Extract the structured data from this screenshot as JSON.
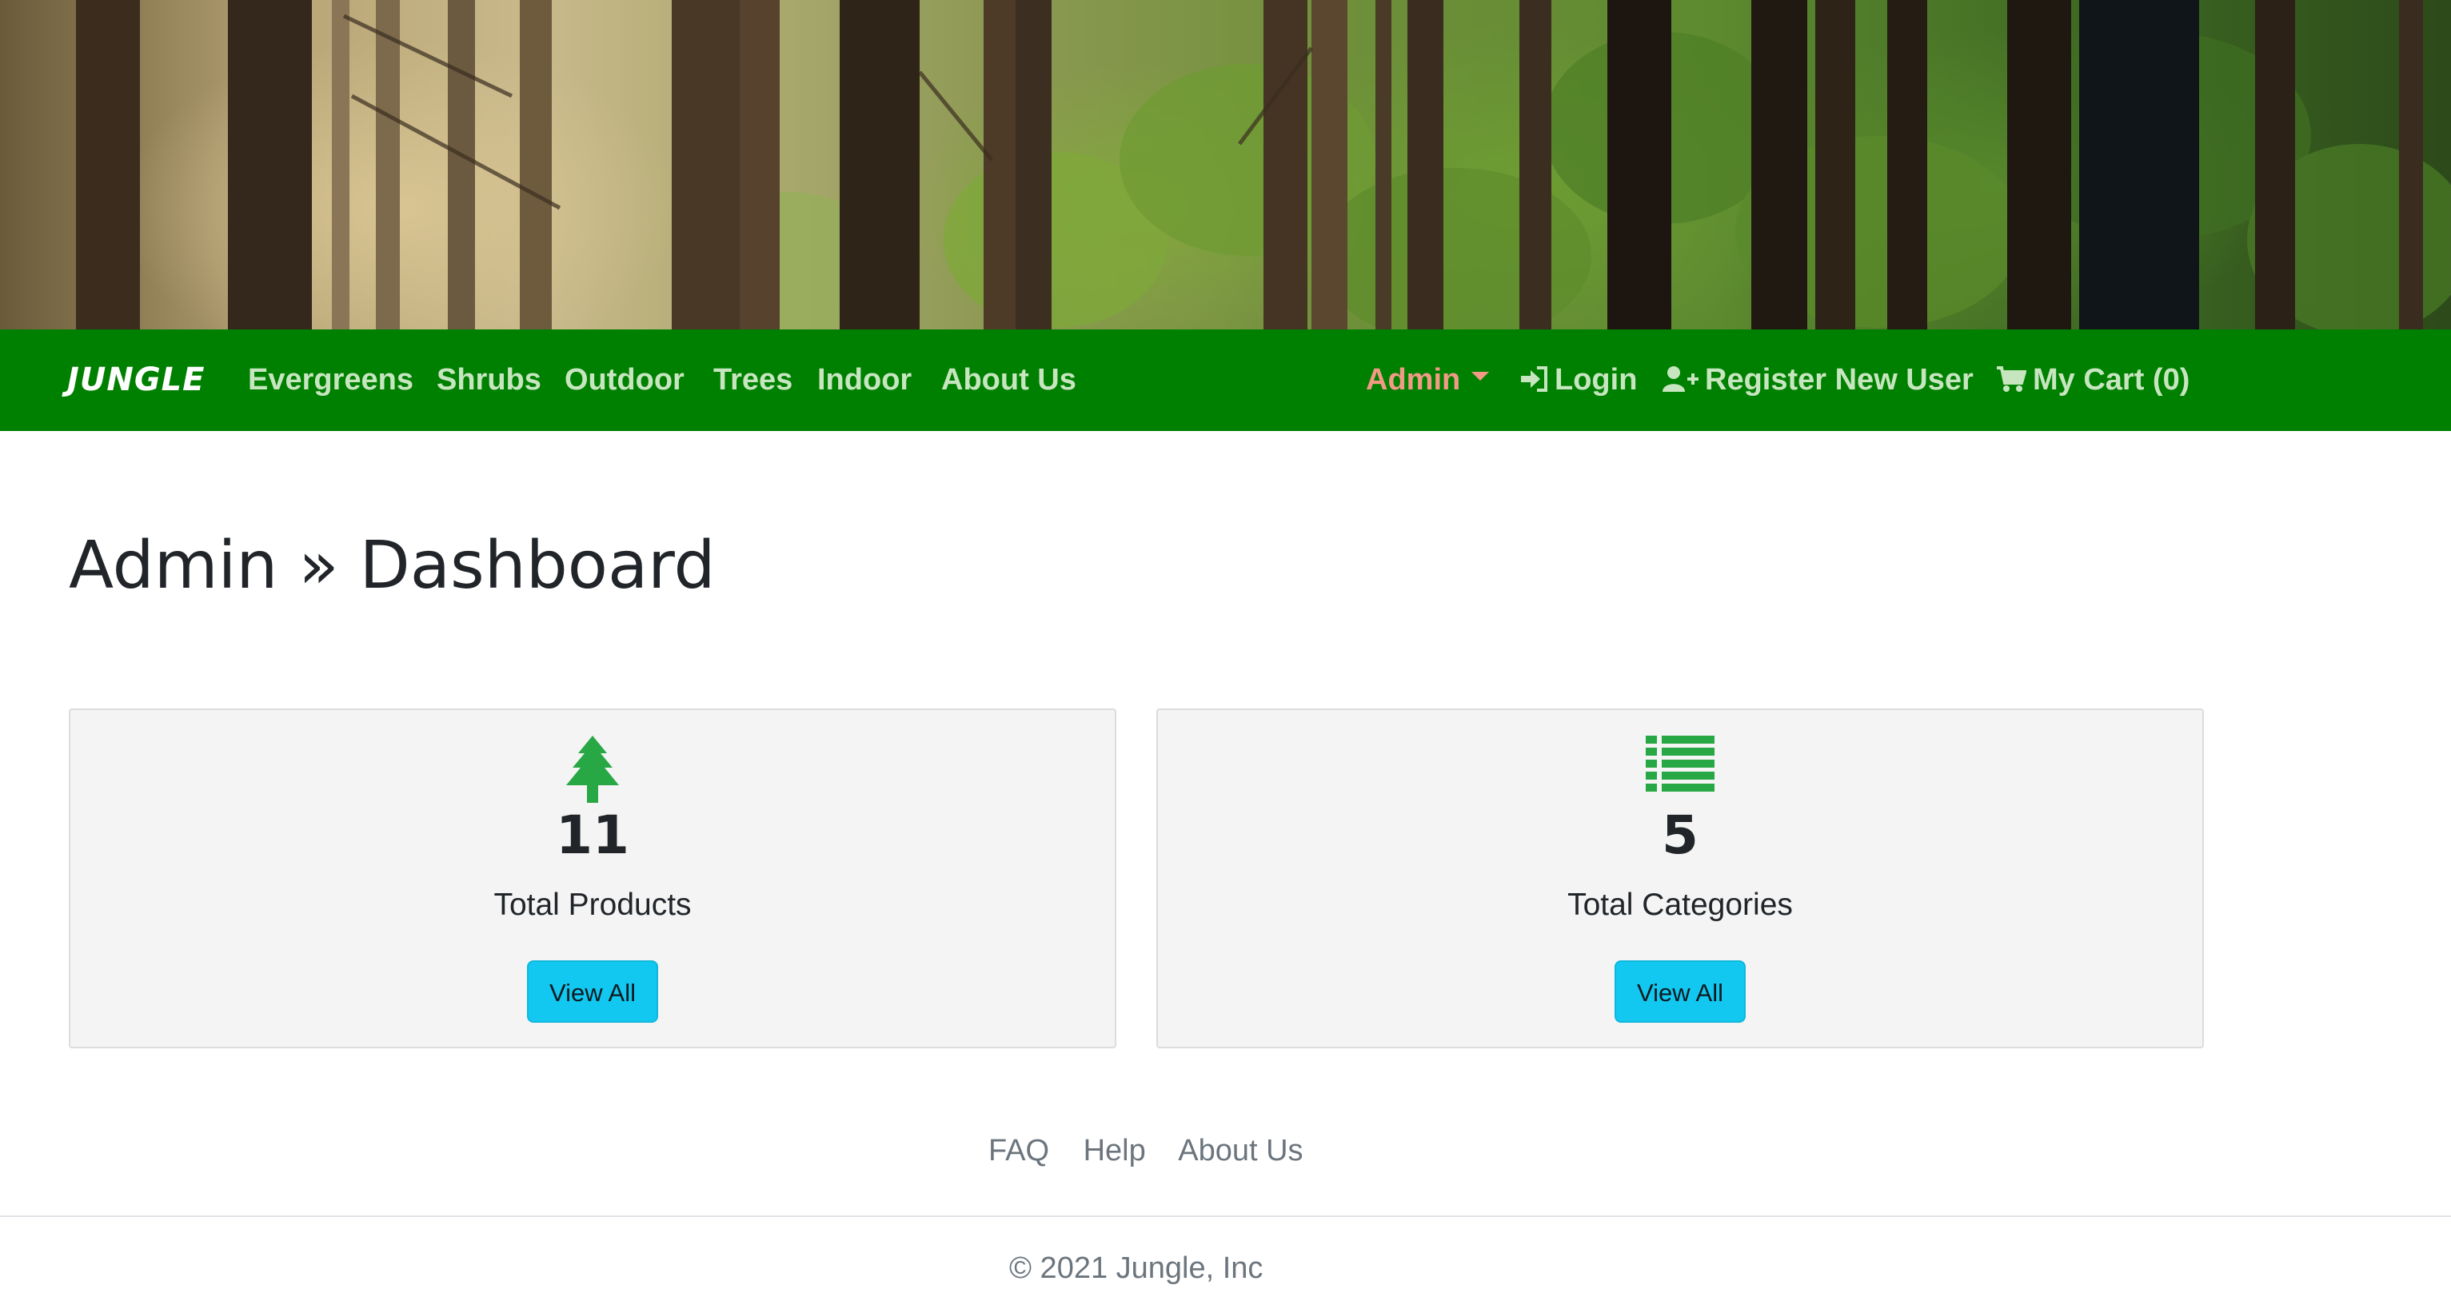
{
  "navbar": {
    "brand": "JUNGLE",
    "links": [
      "Evergreens",
      "Shrubs",
      "Outdoor",
      "Trees",
      "Indoor",
      "About Us"
    ],
    "admin": "Admin",
    "login": "Login",
    "register": "Register New User",
    "cart": "My Cart (0)"
  },
  "page": {
    "title": "Admin » Dashboard"
  },
  "cards": [
    {
      "icon": "tree-icon",
      "count": "11",
      "label": "Total Products",
      "button": "View All"
    },
    {
      "icon": "list-icon",
      "count": "5",
      "label": "Total Categories",
      "button": "View All"
    }
  ],
  "footer": {
    "links": [
      "FAQ",
      "Help",
      "About Us"
    ],
    "copyright": "© 2021 Jungle, Inc"
  },
  "colors": {
    "navbar": "#008000",
    "nav_link": "#c7e6c0",
    "admin_link": "#f29a86",
    "icon_green": "#28a745",
    "button": "#13c8f0"
  }
}
